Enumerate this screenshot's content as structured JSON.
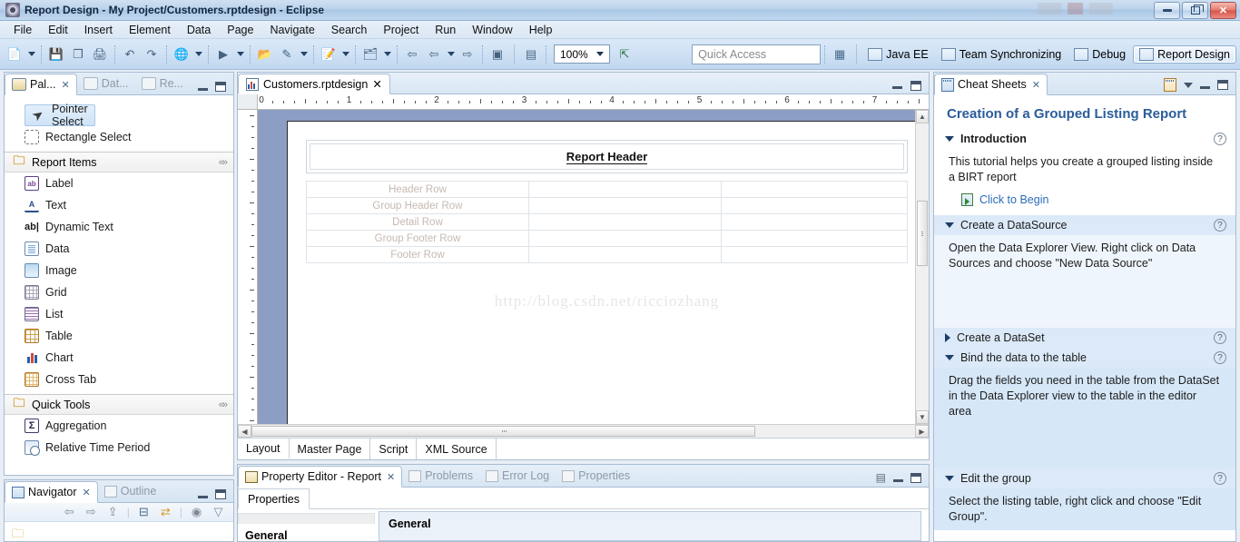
{
  "window": {
    "title": "Report Design - My Project/Customers.rptdesign - Eclipse",
    "app_icon": "eclipse-icon",
    "buttons": {
      "minimize": "minimize-button",
      "restore": "restore-button",
      "close": "close-button"
    }
  },
  "menubar": {
    "items": [
      "File",
      "Edit",
      "Insert",
      "Element",
      "Data",
      "Page",
      "Navigate",
      "Search",
      "Project",
      "Run",
      "Window",
      "Help"
    ]
  },
  "toolbar": {
    "groups": [
      {
        "buttons": [
          {
            "name": "new-report-icon",
            "glyph": "📄",
            "dropdown": true
          }
        ]
      },
      {
        "buttons": [
          {
            "name": "save-icon",
            "glyph": "💾",
            "dropdown": false
          },
          {
            "name": "save-all-icon",
            "glyph": "❐",
            "dropdown": false
          },
          {
            "name": "print-icon",
            "glyph": "🖨",
            "dropdown": false
          }
        ]
      },
      {
        "buttons": [
          {
            "name": "undo-icon",
            "glyph": "↶",
            "dropdown": false
          },
          {
            "name": "redo-icon",
            "glyph": "↷",
            "dropdown": false
          }
        ]
      },
      {
        "buttons": [
          {
            "name": "preview-web-viewer-icon",
            "glyph": "🌐",
            "dropdown": true
          }
        ]
      },
      {
        "buttons": [
          {
            "name": "run-icon",
            "glyph": "▶",
            "dropdown": true
          }
        ]
      },
      {
        "buttons": [
          {
            "name": "open-resource-icon",
            "glyph": "📂",
            "dropdown": false
          },
          {
            "name": "highlight-icon",
            "glyph": "✎",
            "dropdown": true
          }
        ]
      },
      {
        "buttons": [
          {
            "name": "new-report-wizard-icon",
            "glyph": "📝",
            "dropdown": true
          }
        ]
      },
      {
        "buttons": [
          {
            "name": "library-explorer-icon",
            "glyph": "🗂",
            "dropdown": true
          }
        ]
      },
      {
        "buttons": [
          {
            "name": "back-history-icon",
            "glyph": "⇦",
            "dropdown": false
          },
          {
            "name": "previous-icon",
            "glyph": "⇦",
            "dropdown": true
          },
          {
            "name": "next-icon",
            "glyph": "⇨",
            "dropdown": false
          }
        ]
      },
      {
        "buttons": [
          {
            "name": "insert-element-icon",
            "glyph": "▣",
            "dropdown": false
          }
        ]
      }
    ],
    "zoom_value": "100%",
    "zoom_tool_icon": "zoom-pointer-icon",
    "quick_access_placeholder": "Quick Access",
    "open-perspective-icon": "open-perspective-icon",
    "perspectives": [
      {
        "label": "Java EE",
        "icon": "java-ee-perspective-icon",
        "active": false
      },
      {
        "label": "Team Synchronizing",
        "icon": "team-sync-perspective-icon",
        "active": false
      },
      {
        "label": "Debug",
        "icon": "debug-perspective-icon",
        "active": false
      },
      {
        "label": "Report Design",
        "icon": "report-design-perspective-icon",
        "active": true
      }
    ]
  },
  "palette": {
    "tabs": [
      {
        "label": "Pal...",
        "icon": "palette-icon",
        "active": true,
        "closeable": true
      },
      {
        "label": "Dat...",
        "icon": "data-explorer-icon",
        "active": false,
        "closeable": false
      },
      {
        "label": "Re...",
        "icon": "resource-explorer-icon",
        "active": false,
        "closeable": false
      }
    ],
    "tools": [
      {
        "label": "Pointer Select",
        "icon": "pointer-select-icon",
        "selected": true
      },
      {
        "label": "Rectangle Select",
        "icon": "rectangle-select-icon",
        "selected": false
      }
    ],
    "sections": [
      {
        "title": "Report Items",
        "icon": "folder-open-icon",
        "collapse_icon": "collapse-chevrons-icon",
        "items": [
          {
            "label": "Label",
            "icon": "label-item-icon"
          },
          {
            "label": "Text",
            "icon": "text-item-icon"
          },
          {
            "label": "Dynamic Text",
            "icon": "dynamic-text-item-icon"
          },
          {
            "label": "Data",
            "icon": "data-item-icon"
          },
          {
            "label": "Image",
            "icon": "image-item-icon"
          },
          {
            "label": "Grid",
            "icon": "grid-item-icon"
          },
          {
            "label": "List",
            "icon": "list-item-icon"
          },
          {
            "label": "Table",
            "icon": "table-item-icon"
          },
          {
            "label": "Chart",
            "icon": "chart-item-icon"
          },
          {
            "label": "Cross Tab",
            "icon": "cross-tab-item-icon"
          }
        ]
      },
      {
        "title": "Quick Tools",
        "icon": "folder-open-icon",
        "collapse_icon": "collapse-chevrons-icon",
        "items": [
          {
            "label": "Aggregation",
            "icon": "aggregation-icon"
          },
          {
            "label": "Relative Time Period",
            "icon": "relative-time-period-icon"
          }
        ]
      }
    ]
  },
  "navigator": {
    "tabs": [
      {
        "label": "Navigator",
        "icon": "navigator-icon",
        "active": true,
        "closeable": true
      },
      {
        "label": "Outline",
        "icon": "outline-icon",
        "active": false,
        "closeable": false
      }
    ],
    "toolbar_icons": [
      "back-icon",
      "forward-icon",
      "up-icon",
      "collapse-all-icon",
      "link-with-editor-icon",
      "view-menu-filter-icon",
      "view-menu-icon"
    ]
  },
  "editor": {
    "tab": {
      "label": "Customers.rptdesign",
      "icon": "report-file-icon",
      "closeable": true
    },
    "ruler": {
      "unit_labels": [
        "0",
        "1",
        "2",
        "3",
        "4",
        "5",
        "6",
        "7"
      ]
    },
    "report": {
      "header_label": "Report Header",
      "rows": [
        "Header Row",
        "Group Header Row",
        "Detail Row",
        "Group Footer Row",
        "Footer Row"
      ],
      "watermark": "http://blog.csdn.net/ricciozhang"
    },
    "bottom_tabs": [
      {
        "label": "Layout",
        "active": true
      },
      {
        "label": "Master Page",
        "active": false
      },
      {
        "label": "Script",
        "active": false
      },
      {
        "label": "XML Source",
        "active": false
      }
    ]
  },
  "property_editor": {
    "tabs": [
      {
        "label": "Property Editor - Report",
        "icon": "property-editor-icon",
        "active": true,
        "closeable": true
      },
      {
        "label": "Problems",
        "icon": "problems-icon",
        "active": false,
        "closeable": false
      },
      {
        "label": "Error Log",
        "icon": "error-log-icon",
        "active": false,
        "closeable": false
      },
      {
        "label": "Properties",
        "icon": "properties-icon",
        "active": false,
        "closeable": false
      }
    ],
    "sub_tab": "Properties",
    "side_item": "General",
    "section_title": "General",
    "toolbar_icon": "restore-property-icon"
  },
  "cheat_sheets": {
    "tab": {
      "label": "Cheat Sheets",
      "icon": "cheat-sheets-icon",
      "closeable": true
    },
    "toolbar_icons": [
      "cheat-sheet-select-icon",
      "view-menu-icon"
    ],
    "title": "Creation of a Grouped Listing Report",
    "sections": [
      {
        "label": "Introduction",
        "expanded": true,
        "bold": true,
        "shaded": false,
        "body": "This tutorial helps you create a grouped listing inside a BIRT report",
        "link": "Click to Begin",
        "help_icon": "help-icon"
      },
      {
        "label": "Create a DataSource",
        "expanded": true,
        "bold": false,
        "shaded": true,
        "body": "Open the Data Explorer View. Right click on Data Sources and choose \"New Data Source\"",
        "link": null,
        "help_icon": "help-icon"
      },
      {
        "label": "Create a DataSet",
        "expanded": false,
        "bold": false,
        "shaded": true,
        "body": null,
        "link": null,
        "help_icon": "help-icon"
      },
      {
        "label": "Bind the data to the table",
        "expanded": true,
        "bold": false,
        "shaded": true,
        "body": "Drag the fields you need in the table from the DataSet in the Data Explorer view to the table in the editor area",
        "link": null,
        "help_icon": "help-icon"
      },
      {
        "label": "Edit the group",
        "expanded": true,
        "bold": false,
        "shaded": true,
        "body": "Select the listing table, right click and choose \"Edit Group\".",
        "link": null,
        "help_icon": "help-icon"
      }
    ]
  }
}
